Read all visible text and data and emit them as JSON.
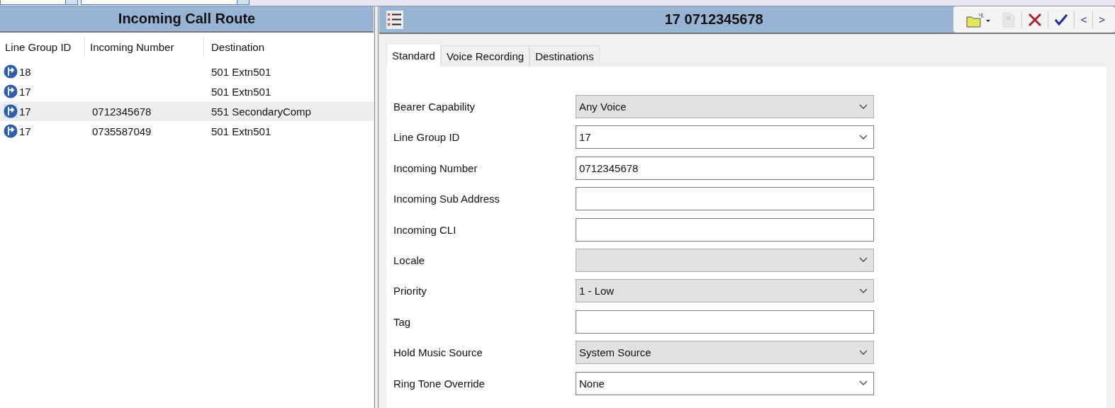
{
  "top_fields": [
    {
      "kind": "combo"
    },
    {
      "kind": "combo"
    }
  ],
  "route_list": {
    "title": "Incoming Call Route",
    "columns": [
      "Line Group ID",
      "Incoming Number",
      "Destination"
    ],
    "rows": [
      {
        "line_group_id": "18",
        "destination": "501 Extn501",
        "selected": false
      },
      {
        "line_group_id": "17",
        "destination": "501 Extn501",
        "selected": false
      },
      {
        "line_group_id": "17",
        "incoming_number": "0712345678",
        "destination": "551 SecondaryComp",
        "selected": true
      },
      {
        "line_group_id": "17",
        "incoming_number": "0735587049",
        "destination": "501 Extn501",
        "selected": false
      }
    ]
  },
  "detail": {
    "title": "17 0712345678",
    "toolbar": [
      {
        "kind": "new",
        "disabled": false
      },
      {
        "kind": "export",
        "disabled": true
      },
      {
        "kind": "delete",
        "disabled": false
      },
      {
        "kind": "ok",
        "disabled": false
      },
      {
        "kind": "prev",
        "label": "<",
        "disabled": false
      },
      {
        "kind": "next",
        "label": ">",
        "disabled": false
      }
    ],
    "tabs": [
      {
        "label": "Standard",
        "selected": true
      },
      {
        "label": "Voice Recording",
        "selected": false
      },
      {
        "label": "Destinations",
        "selected": false
      }
    ],
    "fields": [
      {
        "label": "Bearer Capability",
        "kind": "dropdown",
        "value": "Any Voice"
      },
      {
        "label": "Line Group ID",
        "kind": "combo",
        "value": "17"
      },
      {
        "label": "Incoming Number",
        "kind": "text",
        "value": "0712345678"
      },
      {
        "label": "Incoming Sub Address",
        "kind": "text"
      },
      {
        "label": "Incoming CLI",
        "kind": "text"
      },
      {
        "label": "Locale",
        "kind": "dropdown"
      },
      {
        "label": "Priority",
        "kind": "dropdown",
        "value": "1 - Low"
      },
      {
        "label": "Tag",
        "kind": "text"
      },
      {
        "label": "Hold Music Source",
        "kind": "dropdown",
        "value": "System Source"
      },
      {
        "label": "Ring Tone Override",
        "kind": "combo",
        "value": "None"
      }
    ]
  }
}
